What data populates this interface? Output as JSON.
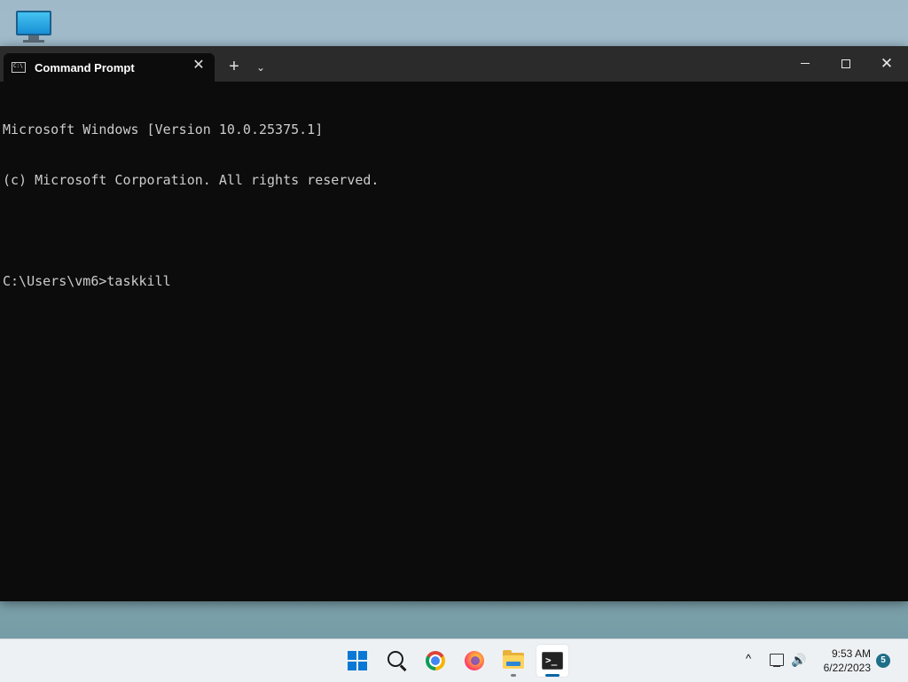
{
  "desktop": {
    "icons": [
      {
        "icon": "monitor-icon"
      }
    ]
  },
  "window": {
    "tab": {
      "title": "Command Prompt",
      "icon": "cmd-icon",
      "icon_text": "C:\\"
    },
    "controls": {
      "close_tab_glyph": "✕",
      "new_tab_glyph": "+",
      "dropdown_glyph": "⌄",
      "close_window_glyph": "✕"
    },
    "console_lines": [
      "Microsoft Windows [Version 10.0.25375.1]",
      "(c) Microsoft Corporation. All rights reserved.",
      "",
      "C:\\Users\\vm6>taskkill"
    ],
    "colors": {
      "background": "#0c0c0c",
      "text": "#cccccc",
      "titlebar": "#2b2b2b"
    }
  },
  "taskbar": {
    "apps": [
      {
        "icon": "windows-start-icon"
      },
      {
        "icon": "search-icon"
      },
      {
        "icon": "chrome-icon"
      },
      {
        "icon": "firefox-icon"
      },
      {
        "icon": "file-explorer-icon"
      },
      {
        "icon": "terminal-icon",
        "active": true
      }
    ],
    "terminal_glyph": ">_",
    "tray": {
      "chevron": "^",
      "volume_glyph": "🔊",
      "time": "9:53 AM",
      "date": "6/22/2023",
      "notification_count": "5"
    },
    "colors": {
      "accent": "#0a78d4",
      "badge": "#1f6f88"
    }
  }
}
